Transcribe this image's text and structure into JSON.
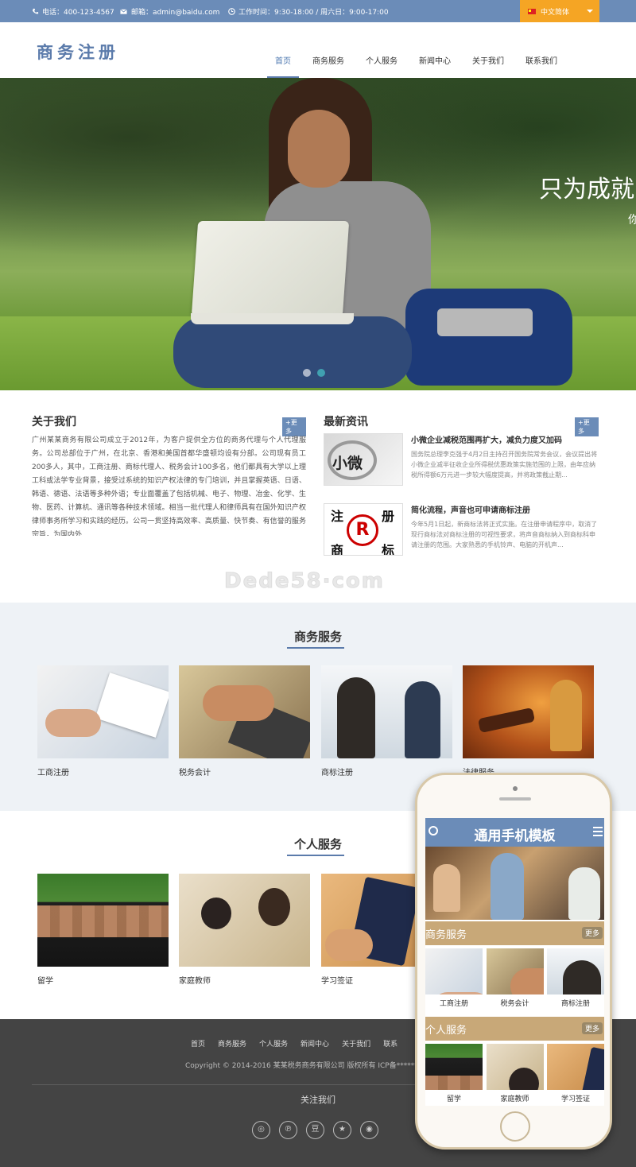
{
  "topbar": {
    "phone": "电话：400-123-4567",
    "email": "邮箱：admin@baidu.com",
    "hours": "工作时间：9:30-18:00 / 周六日：9:00-17:00",
    "language": "中文简体",
    "colors": {
      "bar": "#6b8cb8",
      "language_button": "#f5a524"
    }
  },
  "header": {
    "logo": "商务注册",
    "nav": [
      "首页",
      "商务服务",
      "个人服务",
      "新闻中心",
      "关于我们",
      "联系我们"
    ],
    "active_index": 0
  },
  "hero": {
    "title": "只为成就",
    "subtitle": "你",
    "slide_count": 2,
    "active_slide": 2
  },
  "about": {
    "title": "关于我们",
    "more": "+更多",
    "text": "广州某某商务有限公司成立于2012年，为客户提供全方位的商务代理与个人代理服务。公司总部位于广州，在北京、香港和美国首都华盛顿均设有分部。公司现有员工200多人，其中，工商注册、商标代理人、税务会计100多名，他们都具有大学以上理工科或法学专业背景，接受过系统的知识产权法律的专门培训，并且掌握英语、日语、韩语、德语、法语等多种外语；专业面覆盖了包括机械、电子、物理、冶金、化学、生物、医药、计算机、通讯等各种技术领域。相当一批代理人和律师具有在国外知识产权律师事务所学习和实践的经历。公司一贯坚持高效率、高质量、快节奏、有信誉的服务宗旨，为国内外"
  },
  "news": {
    "title": "最新资讯",
    "more": "+更多",
    "items": [
      {
        "title": "小微企业减税范围再扩大，减负力度又加码",
        "thumb_text": "小微",
        "desc": "国务院总理李克强于4月2日主持召开国务院常务会议，会议提出将小微企业减半征收企业所得税优惠政策实施范围的上限，由年应纳税所得额6万元进一步较大幅度提高，并将政策截止期..."
      },
      {
        "title": "简化流程，声音也可申请商标注册",
        "thumb_text": [
          "注",
          "册",
          "商",
          "标",
          "R"
        ],
        "desc": "今年5月1日起，新商标法将正式实施。在注册申请程序中，取消了现行商标法对商标注册的可视性要求，将声音商标纳入到商标科申请注册的范围。大家熟悉的手机铃声、电脑的开机声..."
      }
    ]
  },
  "watermark": "Dede58·com",
  "business": {
    "title": "商务服务",
    "items": [
      "工商注册",
      "税务会计",
      "商标注册",
      "法律服务"
    ]
  },
  "personal": {
    "title": "个人服务",
    "items": [
      "留学",
      "家庭教师",
      "学习签证"
    ]
  },
  "footer": {
    "nav": [
      "首页",
      "商务服务",
      "个人服务",
      "新闻中心",
      "关于我们",
      "联系"
    ],
    "copyright": "Copyright © 2014-2016 某某税务商务有限公司 版权所有   ICP备*******",
    "follow": "关注我们",
    "socials": [
      "weibo-icon",
      "pinterest-icon",
      "douban-icon",
      "star-icon",
      "renren-icon"
    ],
    "social_glyphs": [
      "◎",
      "℗",
      "豆",
      "★",
      "◉"
    ]
  },
  "phone": {
    "header_title": "通用手机模板",
    "business_bar": "商务服务",
    "personal_bar": "个人服务",
    "more": "更多",
    "business_items": [
      "工商注册",
      "税务会计",
      "商标注册"
    ],
    "personal_items": [
      "留学",
      "家庭教师",
      "学习签证"
    ]
  }
}
